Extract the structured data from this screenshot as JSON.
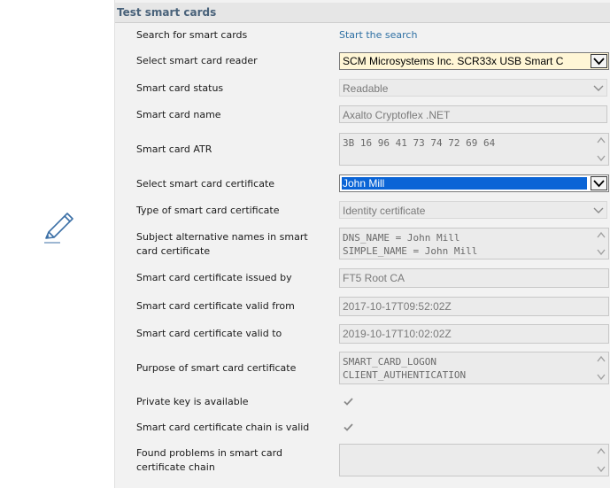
{
  "section_title": "Test smart cards",
  "rows": {
    "search": {
      "label": "Search for smart cards",
      "link": "Start the search"
    },
    "reader": {
      "label": "Select smart card reader",
      "value": "SCM Microsystems Inc. SCR33x USB Smart C"
    },
    "status": {
      "label": "Smart card status",
      "value": "Readable"
    },
    "name": {
      "label": "Smart card name",
      "value": "Axalto Cryptoflex .NET"
    },
    "atr": {
      "label": "Smart card ATR",
      "value": "3B 16 96 41 73 74 72 69 64"
    },
    "certificate": {
      "label": "Select smart card certificate",
      "value": "John Mill"
    },
    "cert_type": {
      "label": "Type of smart card certificate",
      "value": "Identity certificate"
    },
    "san": {
      "label_line1": "Subject alternative names in smart",
      "label_line2": "card certificate",
      "line1": "DNS_NAME = John Mill",
      "line2": "SIMPLE_NAME = John Mill"
    },
    "issuer": {
      "label": "Smart card certificate issued by",
      "value": "FT5 Root CA"
    },
    "valid_from": {
      "label": "Smart card certificate valid from",
      "value": "2017-10-17T09:52:02Z"
    },
    "valid_to": {
      "label": "Smart card certificate valid to",
      "value": "2019-10-17T10:02:02Z"
    },
    "purpose": {
      "label": "Purpose of smart card certificate",
      "line1": "SMART_CARD_LOGON",
      "line2": "CLIENT_AUTHENTICATION"
    },
    "private_key": {
      "label": "Private key is available",
      "checked": true
    },
    "chain_valid": {
      "label": "Smart card certificate chain is valid",
      "checked": true
    },
    "chain_problems": {
      "label_line1": "Found problems in smart card",
      "label_line2": "certificate chain",
      "value": ""
    }
  },
  "icons": {
    "edit": "pencil-icon",
    "dropdown": "chevron-down-icon",
    "scroll_up": "scroll-up-arrow-icon",
    "scroll_down": "scroll-down-arrow-icon",
    "check": "checkmark-icon"
  },
  "colors": {
    "header_text": "#49627a",
    "link": "#2d6fa3",
    "selection": "#0a64d6",
    "reader_bg": "#fff6d6"
  }
}
